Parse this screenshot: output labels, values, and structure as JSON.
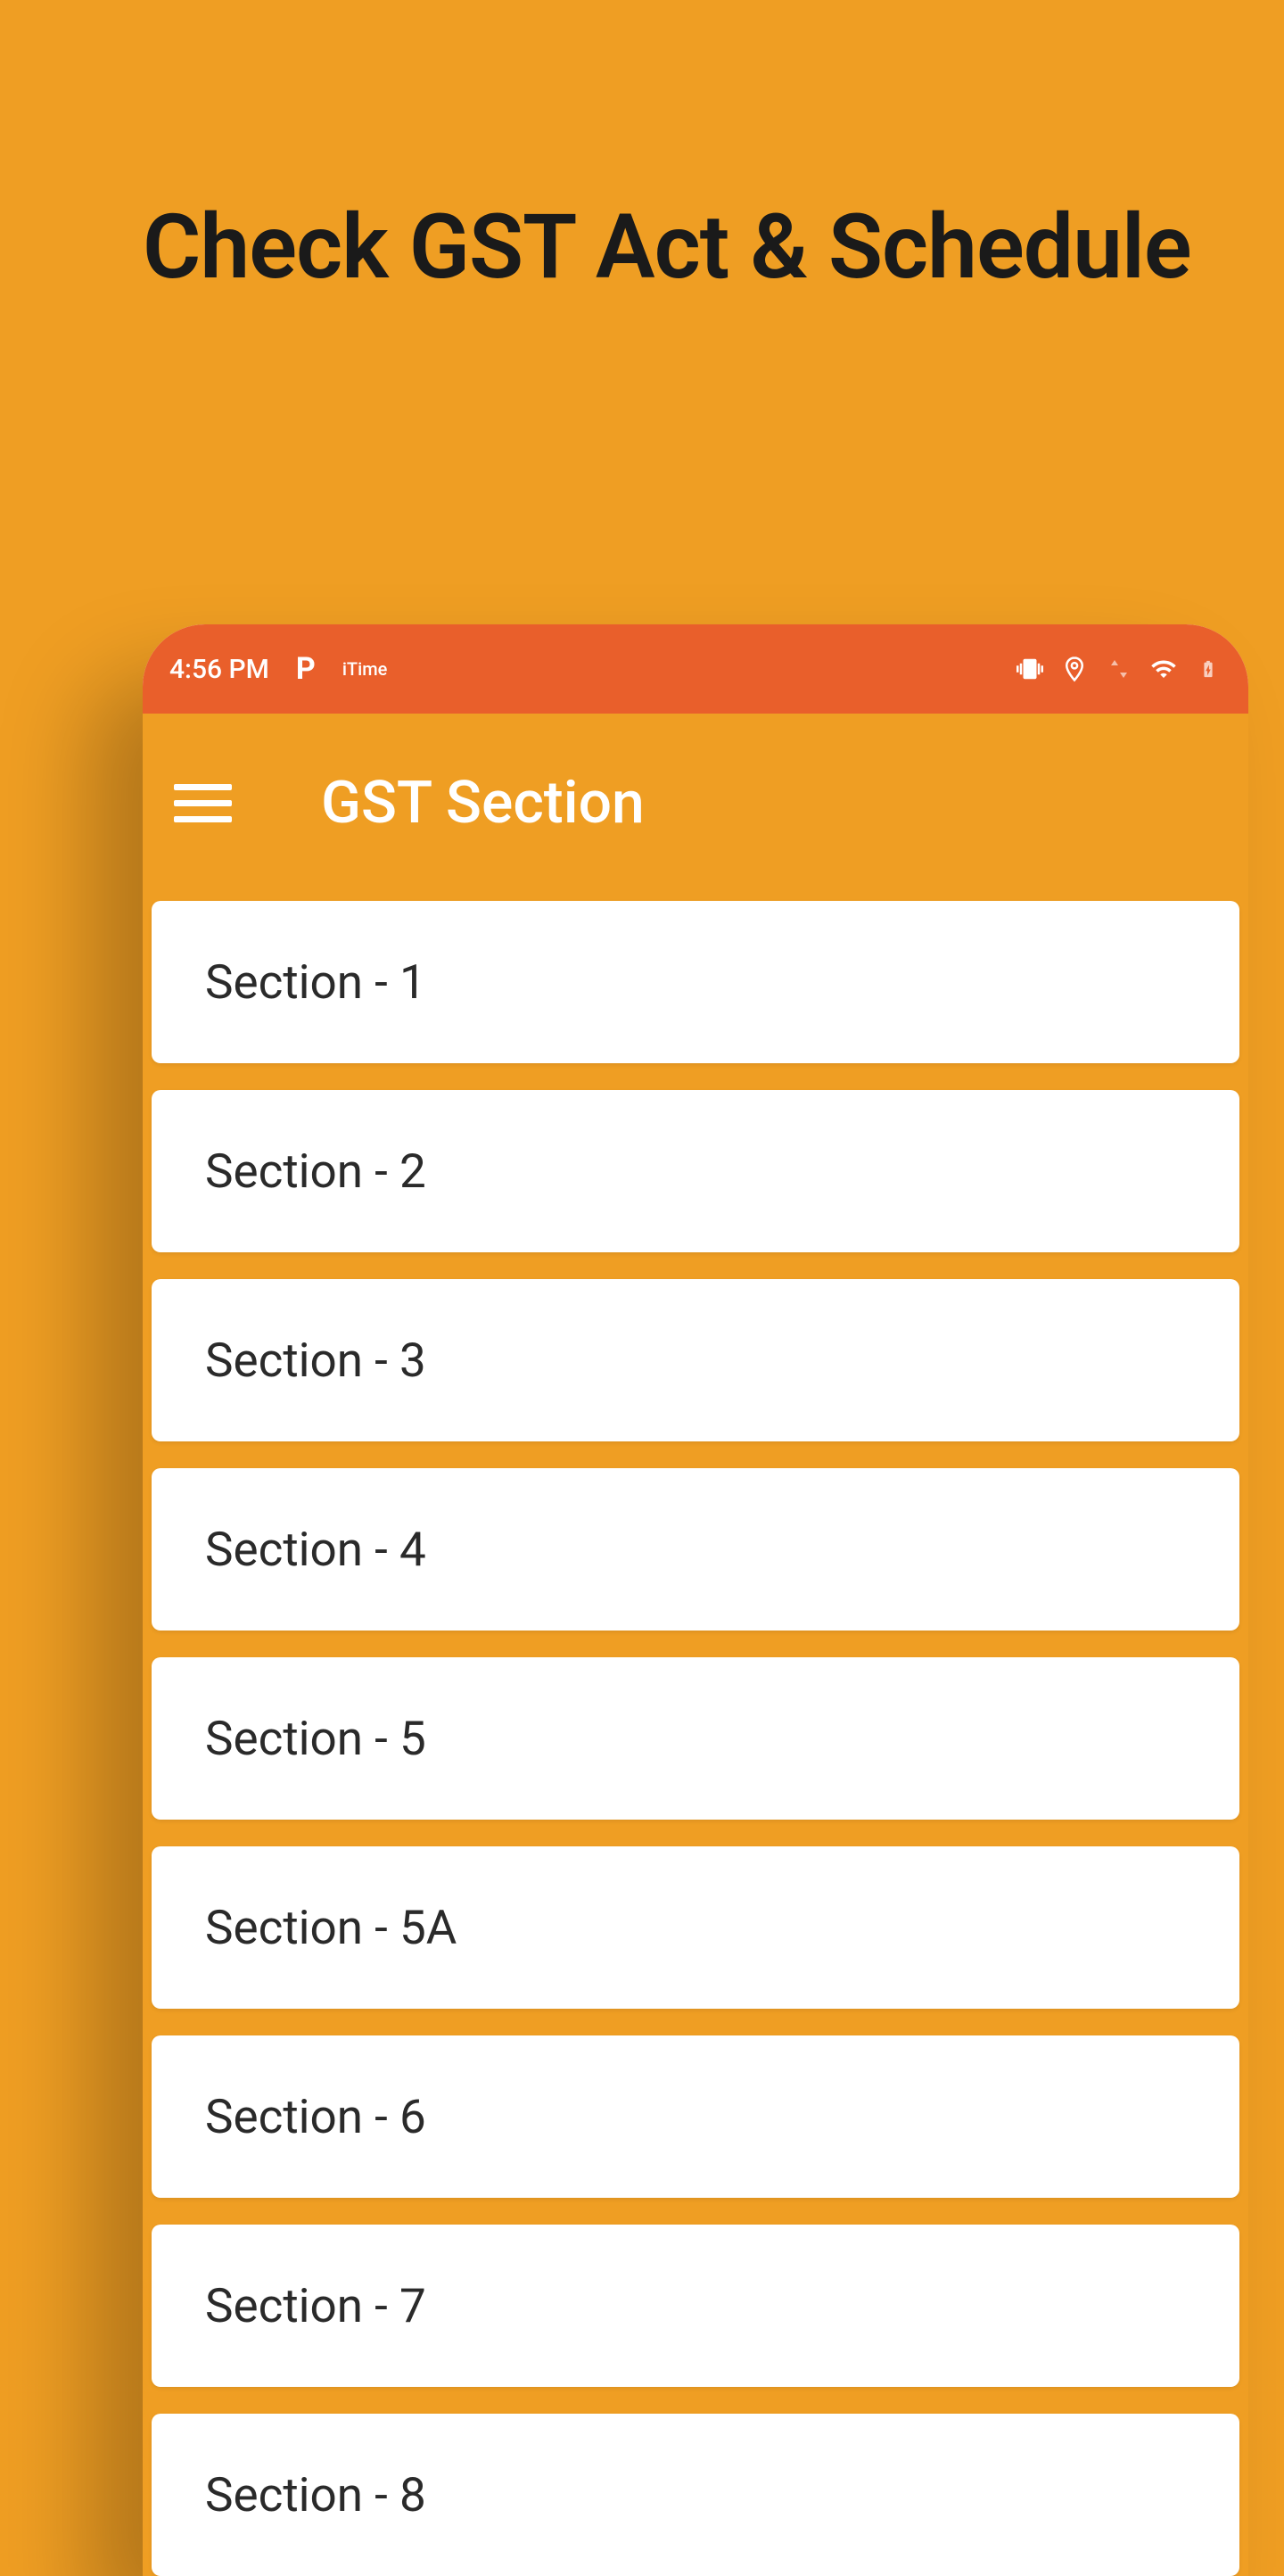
{
  "headline": "Check GST Act & Schedule",
  "status_bar": {
    "time": "4:56 PM",
    "app_indicator": "P",
    "itime": "iTime"
  },
  "app_bar": {
    "title": "GST Section"
  },
  "sections": [
    {
      "label": "Section - 1"
    },
    {
      "label": "Section - 2"
    },
    {
      "label": "Section - 3"
    },
    {
      "label": "Section - 4"
    },
    {
      "label": "Section - 5"
    },
    {
      "label": "Section - 5A"
    },
    {
      "label": "Section - 6"
    },
    {
      "label": "Section - 7"
    },
    {
      "label": "Section - 8"
    }
  ]
}
